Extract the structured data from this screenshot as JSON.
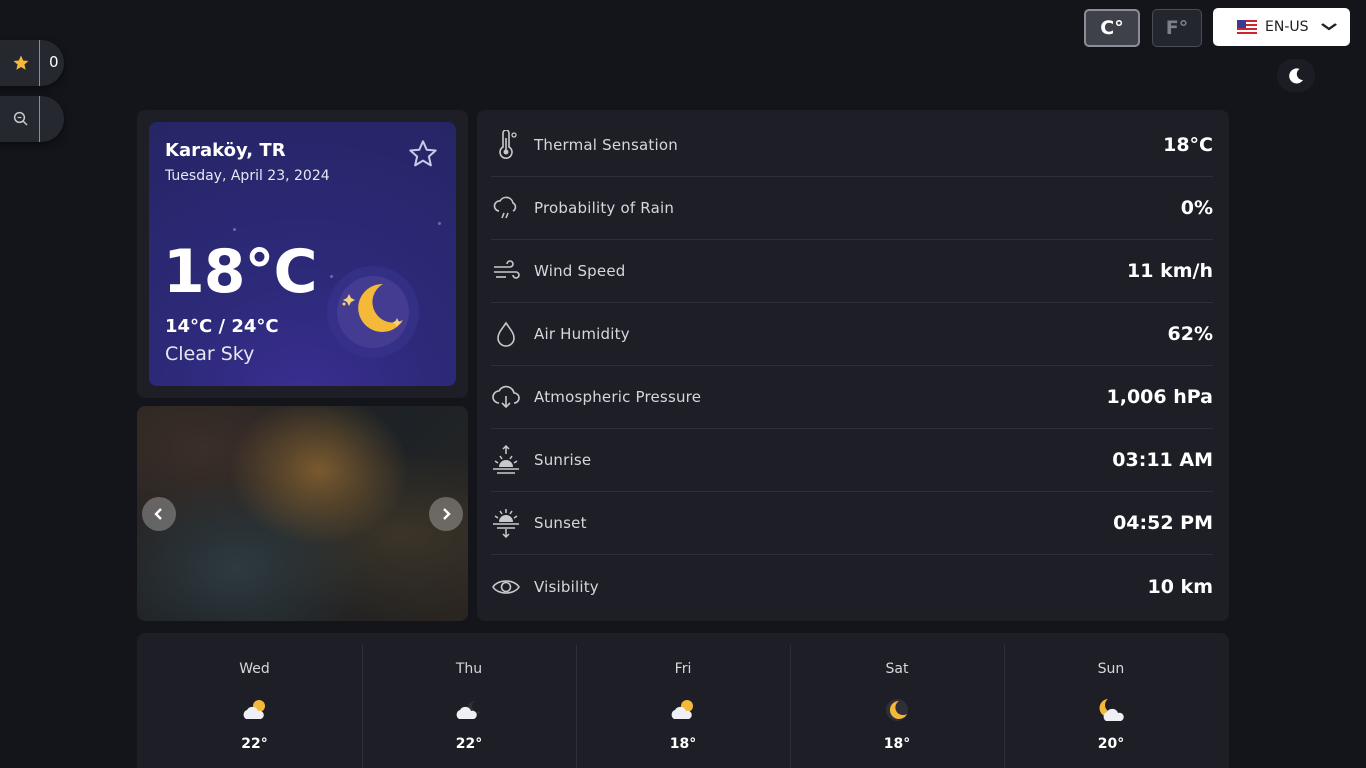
{
  "units": {
    "celsius": "C°",
    "fahrenheit": "F°"
  },
  "language": {
    "selected": "EN-US"
  },
  "favorites": {
    "count": "0"
  },
  "current": {
    "location": "Karaköy, TR",
    "date": "Tuesday, April 23, 2024",
    "temperature": "18°C",
    "min_max": "14°C / 24°C",
    "condition": "Clear Sky"
  },
  "details": [
    {
      "icon": "thermometer-icon",
      "label": "Thermal Sensation",
      "value": "18°C"
    },
    {
      "icon": "rain-cloud-icon",
      "label": "Probability of Rain",
      "value": "0%"
    },
    {
      "icon": "wind-icon",
      "label": "Wind Speed",
      "value": "11 km/h"
    },
    {
      "icon": "droplet-icon",
      "label": "Air Humidity",
      "value": "62%"
    },
    {
      "icon": "pressure-cloud-icon",
      "label": "Atmospheric Pressure",
      "value": "1,006 hPa"
    },
    {
      "icon": "sunrise-icon",
      "label": "Sunrise",
      "value": "03:11 AM"
    },
    {
      "icon": "sunset-icon",
      "label": "Sunset",
      "value": "04:52 PM"
    },
    {
      "icon": "eye-icon",
      "label": "Visibility",
      "value": "10 km"
    }
  ],
  "forecast": [
    {
      "day": "Wed",
      "icon": "partly-cloudy-day-icon",
      "high": "22°",
      "low": ""
    },
    {
      "day": "Thu",
      "icon": "partly-cloudy-night-icon",
      "high": "22°",
      "low": ""
    },
    {
      "day": "Fri",
      "icon": "partly-cloudy-day-icon",
      "high": "18°",
      "low": ""
    },
    {
      "day": "Sat",
      "icon": "moon-icon",
      "high": "18°",
      "low": ""
    },
    {
      "day": "Sun",
      "icon": "cloudy-moon-icon",
      "high": "20°",
      "low": ""
    }
  ],
  "colors": {
    "background": "#14151b",
    "panel": "#1e1f26",
    "card_purple": "#2d2a7a",
    "moon_yellow": "#f5b93a"
  }
}
